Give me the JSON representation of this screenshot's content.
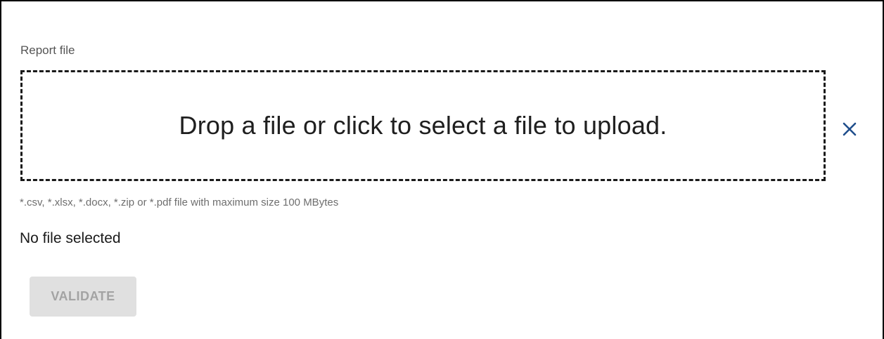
{
  "upload": {
    "label": "Report file",
    "dropzone_text": "Drop a file or click to select a file to upload.",
    "hint": "*.csv, *.xlsx, *.docx, *.zip or *.pdf file with maximum size 100 MBytes",
    "status": "No file selected",
    "clear_icon": "close-icon"
  },
  "actions": {
    "validate_label": "VALIDATE",
    "validate_disabled": true
  },
  "colors": {
    "accent": "#1f4e8c",
    "disabled_bg": "#e0e0e0",
    "disabled_text": "#a3a3a3"
  }
}
